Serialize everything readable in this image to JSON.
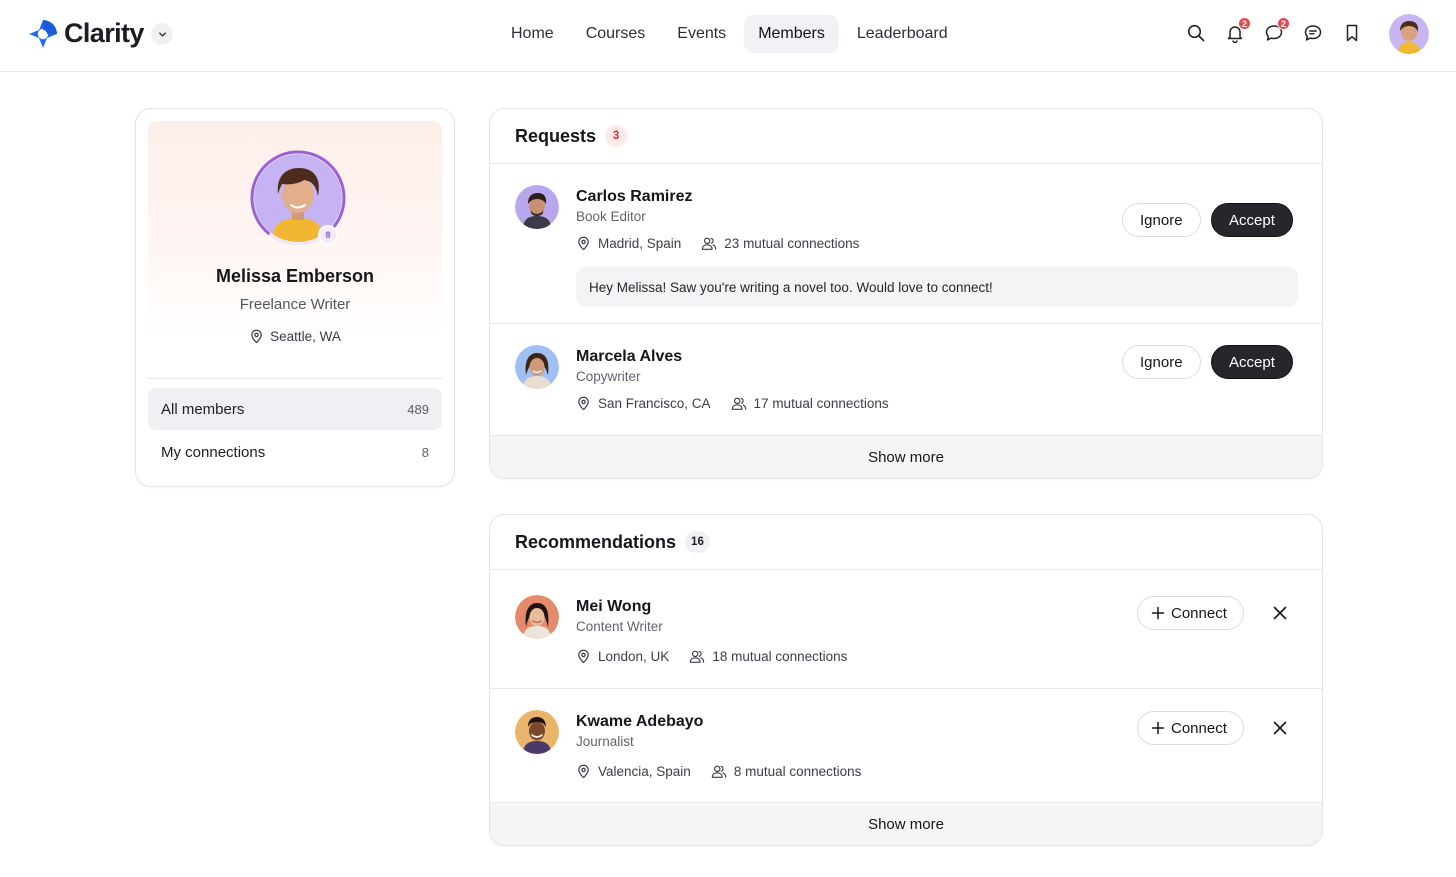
{
  "app": {
    "name": "Clarity",
    "accent_color": "#1f6bf2"
  },
  "nav": {
    "items": [
      {
        "label": "Home",
        "active": false
      },
      {
        "label": "Courses",
        "active": false
      },
      {
        "label": "Events",
        "active": false
      },
      {
        "label": "Members",
        "active": true
      },
      {
        "label": "Leaderboard",
        "active": false
      }
    ]
  },
  "topbar": {
    "icons": [
      "search-icon",
      "bell-icon",
      "chat-icon",
      "message-icon",
      "bookmark-icon"
    ],
    "notifications_count": "2",
    "chats_count": "2"
  },
  "profile": {
    "name": "Melissa Emberson",
    "role": "Freelance Writer",
    "location": "Seattle, WA",
    "level": "8",
    "level_progress": 0.8,
    "links": [
      {
        "label": "All members",
        "count": "489",
        "active": true
      },
      {
        "label": "My connections",
        "count": "8",
        "active": false
      }
    ]
  },
  "requests": {
    "title": "Requests",
    "count": "3",
    "items": [
      {
        "name": "Carlos Ramirez",
        "role": "Book Editor",
        "location": "Madrid, Spain",
        "mutual": "23 mutual connections",
        "message": "Hey Melissa! Saw you're writing a novel too. Would love to connect!",
        "ignore_label": "Ignore",
        "accept_label": "Accept"
      },
      {
        "name": "Marcela Alves",
        "role": "Copywriter",
        "location": "San Francisco, CA",
        "mutual": "17 mutual connections",
        "ignore_label": "Ignore",
        "accept_label": "Accept"
      }
    ],
    "show_more": "Show more"
  },
  "recommendations": {
    "title": "Recommendations",
    "count": "16",
    "items": [
      {
        "name": "Mei Wong",
        "role": "Content Writer",
        "location": "London, UK",
        "mutual": "18 mutual connections",
        "connect_label": "Connect"
      },
      {
        "name": "Kwame Adebayo",
        "role": "Journalist",
        "location": "Valencia, Spain",
        "mutual": "8 mutual connections",
        "connect_label": "Connect"
      }
    ],
    "show_more": "Show more"
  }
}
